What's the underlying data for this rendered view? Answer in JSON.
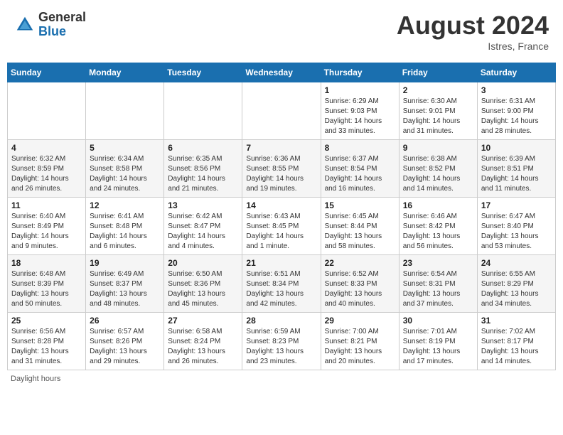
{
  "header": {
    "logo_general": "General",
    "logo_blue": "Blue",
    "month_title": "August 2024",
    "location": "Istres, France"
  },
  "days_of_week": [
    "Sunday",
    "Monday",
    "Tuesday",
    "Wednesday",
    "Thursday",
    "Friday",
    "Saturday"
  ],
  "weeks": [
    [
      {
        "day": "",
        "info": ""
      },
      {
        "day": "",
        "info": ""
      },
      {
        "day": "",
        "info": ""
      },
      {
        "day": "",
        "info": ""
      },
      {
        "day": "1",
        "info": "Sunrise: 6:29 AM\nSunset: 9:03 PM\nDaylight: 14 hours\nand 33 minutes."
      },
      {
        "day": "2",
        "info": "Sunrise: 6:30 AM\nSunset: 9:01 PM\nDaylight: 14 hours\nand 31 minutes."
      },
      {
        "day": "3",
        "info": "Sunrise: 6:31 AM\nSunset: 9:00 PM\nDaylight: 14 hours\nand 28 minutes."
      }
    ],
    [
      {
        "day": "4",
        "info": "Sunrise: 6:32 AM\nSunset: 8:59 PM\nDaylight: 14 hours\nand 26 minutes."
      },
      {
        "day": "5",
        "info": "Sunrise: 6:34 AM\nSunset: 8:58 PM\nDaylight: 14 hours\nand 24 minutes."
      },
      {
        "day": "6",
        "info": "Sunrise: 6:35 AM\nSunset: 8:56 PM\nDaylight: 14 hours\nand 21 minutes."
      },
      {
        "day": "7",
        "info": "Sunrise: 6:36 AM\nSunset: 8:55 PM\nDaylight: 14 hours\nand 19 minutes."
      },
      {
        "day": "8",
        "info": "Sunrise: 6:37 AM\nSunset: 8:54 PM\nDaylight: 14 hours\nand 16 minutes."
      },
      {
        "day": "9",
        "info": "Sunrise: 6:38 AM\nSunset: 8:52 PM\nDaylight: 14 hours\nand 14 minutes."
      },
      {
        "day": "10",
        "info": "Sunrise: 6:39 AM\nSunset: 8:51 PM\nDaylight: 14 hours\nand 11 minutes."
      }
    ],
    [
      {
        "day": "11",
        "info": "Sunrise: 6:40 AM\nSunset: 8:49 PM\nDaylight: 14 hours\nand 9 minutes."
      },
      {
        "day": "12",
        "info": "Sunrise: 6:41 AM\nSunset: 8:48 PM\nDaylight: 14 hours\nand 6 minutes."
      },
      {
        "day": "13",
        "info": "Sunrise: 6:42 AM\nSunset: 8:47 PM\nDaylight: 14 hours\nand 4 minutes."
      },
      {
        "day": "14",
        "info": "Sunrise: 6:43 AM\nSunset: 8:45 PM\nDaylight: 14 hours\nand 1 minute."
      },
      {
        "day": "15",
        "info": "Sunrise: 6:45 AM\nSunset: 8:44 PM\nDaylight: 13 hours\nand 58 minutes."
      },
      {
        "day": "16",
        "info": "Sunrise: 6:46 AM\nSunset: 8:42 PM\nDaylight: 13 hours\nand 56 minutes."
      },
      {
        "day": "17",
        "info": "Sunrise: 6:47 AM\nSunset: 8:40 PM\nDaylight: 13 hours\nand 53 minutes."
      }
    ],
    [
      {
        "day": "18",
        "info": "Sunrise: 6:48 AM\nSunset: 8:39 PM\nDaylight: 13 hours\nand 50 minutes."
      },
      {
        "day": "19",
        "info": "Sunrise: 6:49 AM\nSunset: 8:37 PM\nDaylight: 13 hours\nand 48 minutes."
      },
      {
        "day": "20",
        "info": "Sunrise: 6:50 AM\nSunset: 8:36 PM\nDaylight: 13 hours\nand 45 minutes."
      },
      {
        "day": "21",
        "info": "Sunrise: 6:51 AM\nSunset: 8:34 PM\nDaylight: 13 hours\nand 42 minutes."
      },
      {
        "day": "22",
        "info": "Sunrise: 6:52 AM\nSunset: 8:33 PM\nDaylight: 13 hours\nand 40 minutes."
      },
      {
        "day": "23",
        "info": "Sunrise: 6:54 AM\nSunset: 8:31 PM\nDaylight: 13 hours\nand 37 minutes."
      },
      {
        "day": "24",
        "info": "Sunrise: 6:55 AM\nSunset: 8:29 PM\nDaylight: 13 hours\nand 34 minutes."
      }
    ],
    [
      {
        "day": "25",
        "info": "Sunrise: 6:56 AM\nSunset: 8:28 PM\nDaylight: 13 hours\nand 31 minutes."
      },
      {
        "day": "26",
        "info": "Sunrise: 6:57 AM\nSunset: 8:26 PM\nDaylight: 13 hours\nand 29 minutes."
      },
      {
        "day": "27",
        "info": "Sunrise: 6:58 AM\nSunset: 8:24 PM\nDaylight: 13 hours\nand 26 minutes."
      },
      {
        "day": "28",
        "info": "Sunrise: 6:59 AM\nSunset: 8:23 PM\nDaylight: 13 hours\nand 23 minutes."
      },
      {
        "day": "29",
        "info": "Sunrise: 7:00 AM\nSunset: 8:21 PM\nDaylight: 13 hours\nand 20 minutes."
      },
      {
        "day": "30",
        "info": "Sunrise: 7:01 AM\nSunset: 8:19 PM\nDaylight: 13 hours\nand 17 minutes."
      },
      {
        "day": "31",
        "info": "Sunrise: 7:02 AM\nSunset: 8:17 PM\nDaylight: 13 hours\nand 14 minutes."
      }
    ]
  ],
  "footer": {
    "daylight_label": "Daylight hours"
  }
}
